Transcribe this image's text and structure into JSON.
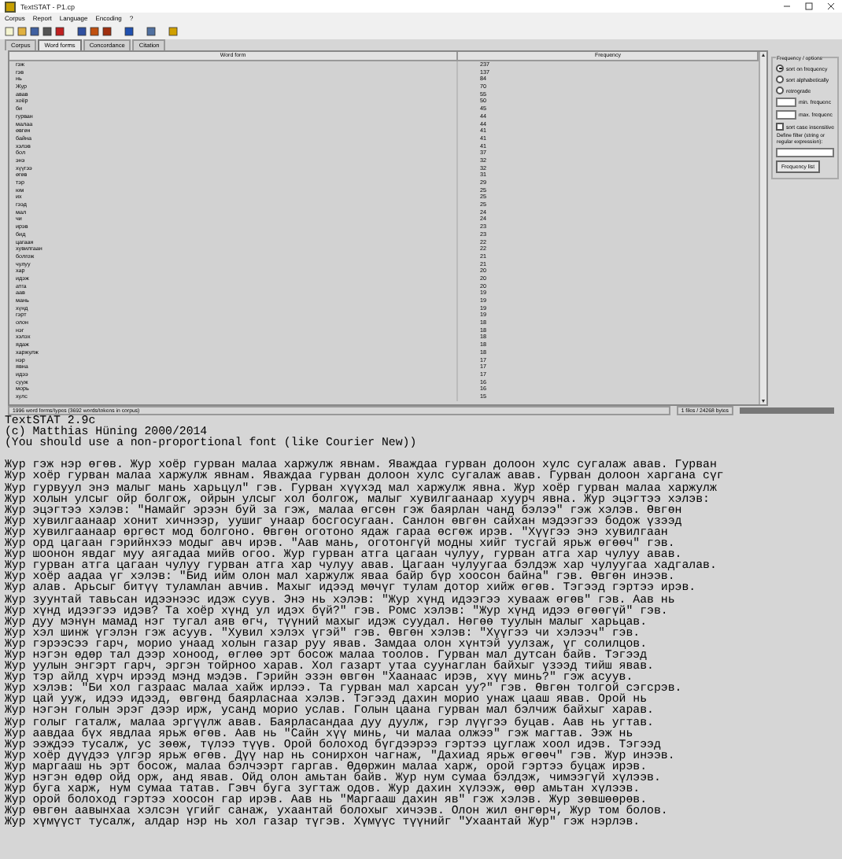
{
  "window": {
    "title": "TextSTAT - P1.cp"
  },
  "menu": [
    "Corpus",
    "Report",
    "Language",
    "Encoding",
    "?"
  ],
  "tabs": [
    {
      "label": "Corpus",
      "selected": false
    },
    {
      "label": "Word forms",
      "selected": true
    },
    {
      "label": "Concordance",
      "selected": false
    },
    {
      "label": "Citation",
      "selected": false
    }
  ],
  "table": {
    "columns": [
      "Word form",
      "Frequency"
    ],
    "rows": [
      [
        "гэж",
        "237"
      ],
      [
        "гэв",
        "137"
      ],
      [
        "нь",
        "84"
      ],
      [
        "Жур",
        "70"
      ],
      [
        "авав",
        "55"
      ],
      [
        "хоёр",
        "50"
      ],
      [
        "би",
        "45"
      ],
      [
        "гурван",
        "44"
      ],
      [
        "малаа",
        "44"
      ],
      [
        "өвгөн",
        "41"
      ],
      [
        "байна",
        "41"
      ],
      [
        "хэлэв",
        "41"
      ],
      [
        "бол",
        "37"
      ],
      [
        "энэ",
        "32"
      ],
      [
        "хүүгээ",
        "32"
      ],
      [
        "өгөв",
        "31"
      ],
      [
        "тэр",
        "29"
      ],
      [
        "юм",
        "25"
      ],
      [
        "их",
        "25"
      ],
      [
        "гээд",
        "25"
      ],
      [
        "мал",
        "24"
      ],
      [
        "чи",
        "24"
      ],
      [
        "ирэв",
        "23"
      ],
      [
        "бид",
        "23"
      ],
      [
        "цагаан",
        "22"
      ],
      [
        "хувилгаан",
        "22"
      ],
      [
        "болгож",
        "21"
      ],
      [
        "чулуу",
        "21"
      ],
      [
        "хар",
        "20"
      ],
      [
        "идэж",
        "20"
      ],
      [
        "атга",
        "20"
      ],
      [
        "аав",
        "19"
      ],
      [
        "мань",
        "19"
      ],
      [
        "хүнд",
        "19"
      ],
      [
        "гэрт",
        "19"
      ],
      [
        "олон",
        "18"
      ],
      [
        "нэг",
        "18"
      ],
      [
        "хэлэх",
        "18"
      ],
      [
        "ядаж",
        "18"
      ],
      [
        "харжулж",
        "18"
      ],
      [
        "нэр",
        "17"
      ],
      [
        "явна",
        "17"
      ],
      [
        "идээ",
        "17"
      ],
      [
        "сууж",
        "16"
      ],
      [
        "морь",
        "16"
      ],
      [
        "хулс",
        "15"
      ]
    ]
  },
  "status_bar": {
    "left": "1996 word forms/types (3692 words/tokens in corpus)",
    "right": "1 files / 24268 bytes"
  },
  "options": {
    "title": "Frequency / options",
    "sort": [
      {
        "label": "sort on frequency",
        "selected": true
      },
      {
        "label": "sort alphabetically",
        "selected": false
      },
      {
        "label": "retrograde",
        "selected": false
      }
    ],
    "min_label": "min. frequenc",
    "max_label": "max. frequenc",
    "case_insensitive": {
      "label": "sort case insensitive",
      "checked": false
    },
    "filter_label": "Define filter (string or regular expression):",
    "button": "Frequency list"
  },
  "output": {
    "header": [
      "TextSTAT 2.9c",
      "(c) Matthias Hüning 2000/2014",
      "(You should use a non-proportional font (like Courier New))"
    ],
    "lines": [
      "Жур гэж нэр өгөв. Жур хоёр гурван малаа харжулж явнам. Яваждаа гурван долоон хулс сугалаж авав. Гурван",
      "Жур хоёр гурван малаа харжулж явнам. Яваждаа гурван долоон хулс сугалаж авав. Гурван долоон харгана сүг",
      "Жур гурвуул энэ малыг мань харьцул\" гэв. Гурван хүүхэд мал харжулж явна. Жур хоёр гурван малаа харжулж",
      "Жур холын улсыг ойр болгож, ойрын улсыг хол болгож, малыг хувилгаанаар хуурч явна. Жур эцэгтээ хэлэв:",
      "Жур эцэгтээ хэлэв: \"Намайг эрээн буй за гэж, малаа өгсөн гэж баярлан чанд бэлээ\" гэж хэлэв. Өвгөн",
      "Жур хувилгаанаар хонит хичнээр, уушиг унаар босгосугаан. Санлон өвгөн сайхан мэдээгээ бодож үзээд",
      "Жур хувилгаанаар өргөст мод болгоно. Өвгөн оготоно ядаж гараа өсгөж ирэв. \"Хүүгээ энэ хувилгаан",
      "Жур орд цагаан гэрийнхээ модыг авч ирэв. \"Аав мань, оготонгүй модны хийг тусгай ярьж өгөөч\" гэв.",
      "Жур шоонон явдаг муу аягадаа мийв огоо. Жур гурван атга цагаан чулуу, гурван атга хар чулуу авав.",
      "Жур гурван атга цагаан чулуу гурван атга хар чулуу авав. Цагаан чулуугаа бэлдэж хар чулуугаа хадгалав.",
      "Жур хоёр аадаа үг хэлэв: \"Бид ийм олон мал харжулж яваа байр бүр хоосон байна\" гэв. Өвгөн инээв.",
      "Жур алав. Арьсыг битүү туламлан авчив. Махыг идээд мөчүг тулам дотор хийж өгөв. Тэгээд гэртээ ирэв.",
      "Жур зуунтай тавьсан идээнээс идэж суув. Энэ нь хэлэв: \"Жур хүнд идээгээ хувааж өгөв\" гэв. Аав нь",
      "Жур хүнд идээгээ идэв? Та хоёр хүнд ул идэх бүй?\" гэв. Ромс хэлэв: \"Жур хүнд идээ өгөөгүй\" гэв.",
      "Жур дуу мэнүн мамад нэг тугал аяв өгч, түүний махыг идэж суудал. Нөгөө туулын малыг харьцав.",
      "Жур хэл шинж үгэлэн гэж асуув. \"Хувил хэлэх үгэй\" гэв. Өвгөн хэлэв: \"Хүүгээ чи хэлээч\" гэв.",
      "Жур гэрээсээ гарч, морио унаад холын газар руу явав. Замдаа олон хүнтэй уулзаж, үг солилцов.",
      "Жур нэгэн өдөр тал дээр хоноод, өглөө эрт босож малаа тоолов. Гурван мал дутсан байв. Тэгээд",
      "Жур уулын энгэрт гарч, эргэн тойрноо харав. Хол газарт утаа суунаглан байхыг үзээд тийш явав.",
      "Жур тэр айлд хүрч ирээд мэнд мэдэв. Гэрийн эзэн өвгөн \"Хаанаас ирэв, хүү минь?\" гэж асуув.",
      "Жур хэлэв: \"Би хол газраас малаа хайж ирлээ. Та гурван мал харсан уу?\" гэв. Өвгөн толгой сэгсрэв.",
      "Жур цай ууж, идээ идээд, өвгөнд баярласнаа хэлэв. Тэгээд дахин морио унаж цааш явав. Орой нь",
      "Жур нэгэн голын эрэг дээр ирж, усанд морио услав. Голын цаана гурван мал бэлчиж байхыг харав.",
      "Жур голыг гаталж, малаа эргүүлж авав. Баярласандаа дуу дуулж, гэр лүүгээ буцав. Аав нь угтав.",
      "Жур аавдаа бүх явдлаа ярьж өгөв. Аав нь \"Сайн хүү минь, чи малаа олжээ\" гэж магтав. Ээж нь",
      "Жур ээждээ тусалж, ус зөөж, түлээ түүв. Орой болоход бүгдээрээ гэртээ цуглаж хоол идэв. Тэгээд",
      "Жур хоёр дүүдээ үлгэр ярьж өгөв. Дүү нар нь сонирхон чагнаж, \"Дахиад ярьж өгөөч\" гэв. Жур инээв.",
      "Жур маргааш нь эрт босож, малаа бэлчээрт гаргав. Өдөржин малаа харж, орой гэртээ буцаж ирэв.",
      "Жур нэгэн өдөр ойд орж, анд явав. Ойд олон амьтан байв. Жур нум сумаа бэлдэж, чимээгүй хүлээв.",
      "Жур буга харж, нум сумаа татав. Гэвч буга зугтаж одов. Жур дахин хүлээж, өөр амьтан хүлээв.",
      "Жур орой болоход гэртээ хоосон гар ирэв. Аав нь \"Маргааш дахин яв\" гэж хэлэв. Жур зөвшөөрөв.",
      "Жур өвгөн аавынхаа хэлсэн үгийг санаж, ухаантай болохыг хичээв. Олон жил өнгөрч, Жур том болов.",
      "Жур хүмүүст тусалж, алдар нэр нь хол газар түгэв. Хүмүүс түүнийг \"Ухаантай Жур\" гэж нэрлэв."
    ]
  }
}
